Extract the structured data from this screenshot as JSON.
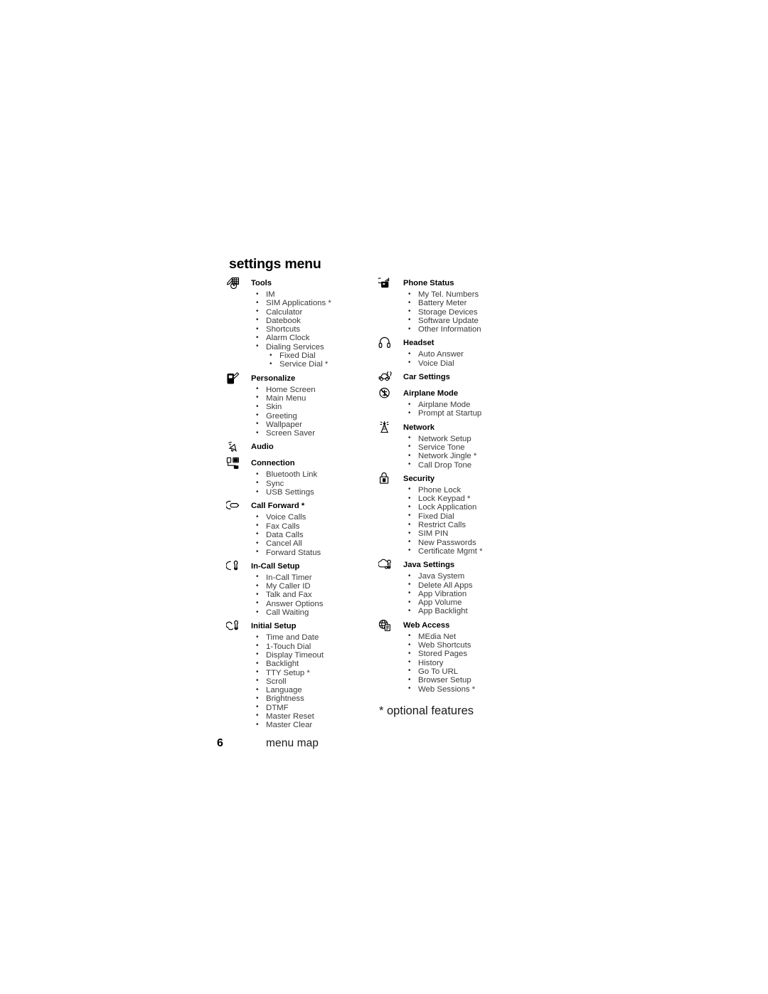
{
  "page": {
    "title": "settings menu",
    "footnote": "* optional features",
    "page_number": "6",
    "footer_label": "menu map"
  },
  "columns": {
    "left": [
      {
        "icon": "tools-icon",
        "title": "Tools",
        "items": [
          {
            "label": "IM",
            "level": 1
          },
          {
            "label": "SIM Applications *",
            "level": 1
          },
          {
            "label": "Calculator",
            "level": 1
          },
          {
            "label": "Datebook",
            "level": 1
          },
          {
            "label": "Shortcuts",
            "level": 1
          },
          {
            "label": "Alarm Clock",
            "level": 1
          },
          {
            "label": "Dialing Services",
            "level": 1
          },
          {
            "label": "Fixed Dial",
            "level": 2
          },
          {
            "label": "Service Dial *",
            "level": 2
          }
        ]
      },
      {
        "icon": "personalize-icon",
        "title": "Personalize",
        "items": [
          {
            "label": "Home Screen",
            "level": 1
          },
          {
            "label": "Main Menu",
            "level": 1
          },
          {
            "label": "Skin",
            "level": 1
          },
          {
            "label": "Greeting",
            "level": 1
          },
          {
            "label": "Wallpaper",
            "level": 1
          },
          {
            "label": "Screen Saver",
            "level": 1
          }
        ]
      },
      {
        "icon": "audio-icon",
        "title": "Audio",
        "items": []
      },
      {
        "icon": "connection-icon",
        "title": "Connection",
        "items": [
          {
            "label": "Bluetooth Link",
            "level": 1
          },
          {
            "label": "Sync",
            "level": 1
          },
          {
            "label": "USB Settings",
            "level": 1
          }
        ]
      },
      {
        "icon": "call-forward-icon",
        "title": "Call Forward *",
        "items": [
          {
            "label": "Voice Calls",
            "level": 1
          },
          {
            "label": "Fax Calls",
            "level": 1
          },
          {
            "label": "Data Calls",
            "level": 1
          },
          {
            "label": "Cancel All",
            "level": 1
          },
          {
            "label": "Forward Status",
            "level": 1
          }
        ]
      },
      {
        "icon": "in-call-setup-icon",
        "title": "In-Call Setup",
        "items": [
          {
            "label": "In-Call Timer",
            "level": 1
          },
          {
            "label": "My Caller ID",
            "level": 1
          },
          {
            "label": "Talk and Fax",
            "level": 1
          },
          {
            "label": "Answer Options",
            "level": 1
          },
          {
            "label": "Call Waiting",
            "level": 1
          }
        ]
      },
      {
        "icon": "initial-setup-icon",
        "title": "Initial Setup",
        "items": [
          {
            "label": "Time and Date",
            "level": 1
          },
          {
            "label": "1-Touch Dial",
            "level": 1
          },
          {
            "label": "Display Timeout",
            "level": 1
          },
          {
            "label": "Backlight",
            "level": 1
          },
          {
            "label": "TTY Setup *",
            "level": 1
          },
          {
            "label": "Scroll",
            "level": 1
          },
          {
            "label": "Language",
            "level": 1
          },
          {
            "label": "Brightness",
            "level": 1
          },
          {
            "label": "DTMF",
            "level": 1
          },
          {
            "label": "Master Reset",
            "level": 1
          },
          {
            "label": "Master Clear",
            "level": 1
          }
        ]
      }
    ],
    "right": [
      {
        "icon": "phone-status-icon",
        "title": "Phone Status",
        "items": [
          {
            "label": "My Tel. Numbers",
            "level": 1
          },
          {
            "label": "Battery Meter",
            "level": 1
          },
          {
            "label": "Storage Devices",
            "level": 1
          },
          {
            "label": "Software Update",
            "level": 1
          },
          {
            "label": "Other Information",
            "level": 1
          }
        ]
      },
      {
        "icon": "headset-icon",
        "title": "Headset",
        "items": [
          {
            "label": "Auto Answer",
            "level": 1
          },
          {
            "label": "Voice Dial",
            "level": 1
          }
        ]
      },
      {
        "icon": "car-settings-icon",
        "title": "Car Settings",
        "items": []
      },
      {
        "icon": "airplane-mode-icon",
        "title": "Airplane Mode",
        "items": [
          {
            "label": "Airplane Mode",
            "level": 1
          },
          {
            "label": "Prompt at Startup",
            "level": 1
          }
        ]
      },
      {
        "icon": "network-icon",
        "title": "Network",
        "items": [
          {
            "label": "Network Setup",
            "level": 1
          },
          {
            "label": "Service Tone",
            "level": 1
          },
          {
            "label": "Network Jingle *",
            "level": 1
          },
          {
            "label": "Call Drop Tone",
            "level": 1
          }
        ]
      },
      {
        "icon": "security-icon",
        "title": "Security",
        "items": [
          {
            "label": "Phone Lock",
            "level": 1
          },
          {
            "label": "Lock Keypad *",
            "level": 1
          },
          {
            "label": "Lock Application",
            "level": 1
          },
          {
            "label": "Fixed Dial",
            "level": 1
          },
          {
            "label": "Restrict Calls",
            "level": 1
          },
          {
            "label": "SIM PIN",
            "level": 1
          },
          {
            "label": "New Passwords",
            "level": 1
          },
          {
            "label": "Certificate Mgmt *",
            "level": 1
          }
        ]
      },
      {
        "icon": "java-settings-icon",
        "title": "Java Settings",
        "items": [
          {
            "label": "Java System",
            "level": 1
          },
          {
            "label": "Delete All Apps",
            "level": 1
          },
          {
            "label": "App Vibration",
            "level": 1
          },
          {
            "label": "App Volume",
            "level": 1
          },
          {
            "label": "App Backlight",
            "level": 1
          }
        ]
      },
      {
        "icon": "web-access-icon",
        "title": "Web Access",
        "items": [
          {
            "label": "MEdia Net",
            "level": 1
          },
          {
            "label": "Web Shortcuts",
            "level": 1
          },
          {
            "label": "Stored Pages",
            "level": 1
          },
          {
            "label": "History",
            "level": 1
          },
          {
            "label": "Go To URL",
            "level": 1
          },
          {
            "label": "Browser Setup",
            "level": 1
          },
          {
            "label": "Web Sessions *",
            "level": 1
          }
        ]
      }
    ]
  }
}
